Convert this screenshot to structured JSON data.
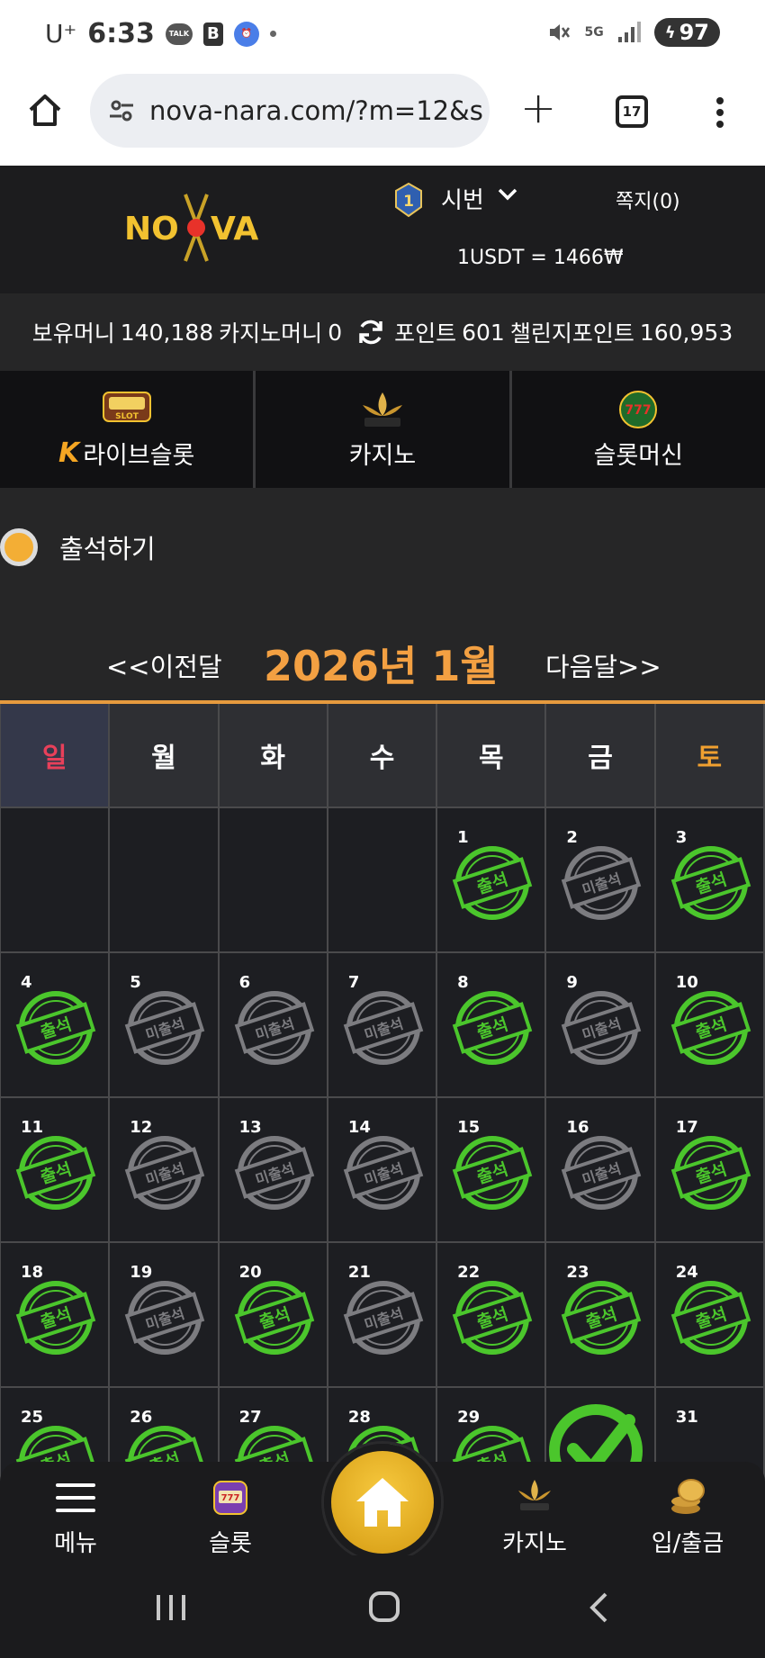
{
  "status_bar": {
    "carrier": "U⁺",
    "time": "6:33",
    "network": "5G",
    "battery": "97"
  },
  "browser": {
    "url": "nova-nara.com/?m=12&s",
    "tab_count": "17"
  },
  "header": {
    "username": "시번",
    "memo": "쪽지(0)",
    "rate": "1USDT = 1466₩"
  },
  "money": {
    "cash_label": "보유머니",
    "cash_value": "140,188",
    "casino_label": "카지노머니",
    "casino_value": "0",
    "point_label": "포인트",
    "point_value": "601",
    "challenge_label": "챌린지포인트",
    "challenge_value": "160,953"
  },
  "categories": [
    {
      "label": "라이브슬롯",
      "icon": "live-slot-icon"
    },
    {
      "label": "카지노",
      "icon": "k-slot-icon"
    },
    {
      "label": "슬롯머신",
      "icon": "777-slots-icon"
    }
  ],
  "section_title": "출석하기",
  "month_nav": {
    "prev": "<<이전달",
    "title": "2026년 1월",
    "next": "다음달>>"
  },
  "weekdays": [
    "일",
    "월",
    "화",
    "수",
    "목",
    "금",
    "토"
  ],
  "stamp_labels": {
    "attended": "출석",
    "missed": "미출석"
  },
  "calendar": [
    {
      "day": ""
    },
    {
      "day": ""
    },
    {
      "day": ""
    },
    {
      "day": ""
    },
    {
      "day": "1",
      "status": "attended"
    },
    {
      "day": "2",
      "status": "missed"
    },
    {
      "day": "3",
      "status": "attended"
    },
    {
      "day": "4",
      "status": "attended"
    },
    {
      "day": "5",
      "status": "missed"
    },
    {
      "day": "6",
      "status": "missed"
    },
    {
      "day": "7",
      "status": "missed"
    },
    {
      "day": "8",
      "status": "attended"
    },
    {
      "day": "9",
      "status": "missed"
    },
    {
      "day": "10",
      "status": "attended"
    },
    {
      "day": "11",
      "status": "attended"
    },
    {
      "day": "12",
      "status": "missed"
    },
    {
      "day": "13",
      "status": "missed"
    },
    {
      "day": "14",
      "status": "missed"
    },
    {
      "day": "15",
      "status": "attended"
    },
    {
      "day": "16",
      "status": "missed"
    },
    {
      "day": "17",
      "status": "attended"
    },
    {
      "day": "18",
      "status": "attended"
    },
    {
      "day": "19",
      "status": "missed"
    },
    {
      "day": "20",
      "status": "attended"
    },
    {
      "day": "21",
      "status": "missed"
    },
    {
      "day": "22",
      "status": "attended"
    },
    {
      "day": "23",
      "status": "attended"
    },
    {
      "day": "24",
      "status": "attended"
    },
    {
      "day": "25",
      "status": "attended"
    },
    {
      "day": "26",
      "status": "attended"
    },
    {
      "day": "27",
      "status": "attended"
    },
    {
      "day": "28",
      "status": "attended"
    },
    {
      "day": "29",
      "status": "attended"
    },
    {
      "day": "",
      "status": "today-check"
    },
    {
      "day": "31",
      "status": ""
    }
  ],
  "bottom_nav": [
    {
      "label": "메뉴",
      "icon": "menu-icon"
    },
    {
      "label": "슬롯",
      "icon": "slot-icon"
    },
    {
      "label": "",
      "icon": "home-icon"
    },
    {
      "label": "카지노",
      "icon": "casino-icon"
    },
    {
      "label": "입/출금",
      "icon": "coins-icon"
    }
  ],
  "colors": {
    "accent": "#f3a042",
    "attended": "#4bc62c",
    "missed": "#7c7c80",
    "sunday": "#e8405a",
    "saturday": "#f0a030"
  }
}
